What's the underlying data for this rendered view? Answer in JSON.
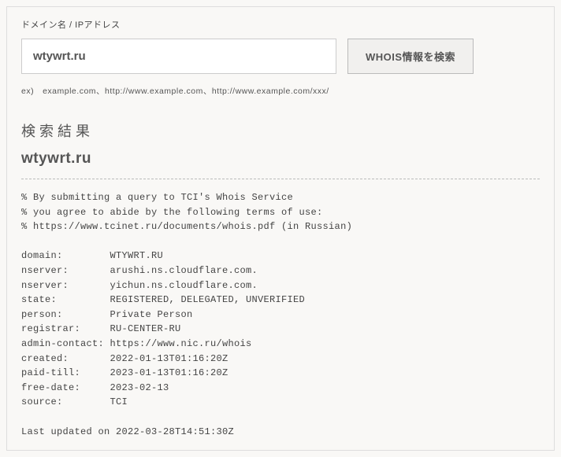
{
  "form": {
    "label": "ドメイン名 / IPアドレス",
    "input_value": "wtywrt.ru",
    "button_label": "WHOIS情報を検索",
    "example_text": "ex)　example.com、http://www.example.com、http://www.example.com/xxx/"
  },
  "result": {
    "heading": "検索結果",
    "domain": "wtywrt.ru",
    "whois_text": "% By submitting a query to TCI's Whois Service\n% you agree to abide by the following terms of use:\n% https://www.tcinet.ru/documents/whois.pdf (in Russian)\n\ndomain:        WTYWRT.RU\nnserver:       arushi.ns.cloudflare.com.\nnserver:       yichun.ns.cloudflare.com.\nstate:         REGISTERED, DELEGATED, UNVERIFIED\nperson:        Private Person\nregistrar:     RU-CENTER-RU\nadmin-contact: https://www.nic.ru/whois\ncreated:       2022-01-13T01:16:20Z\npaid-till:     2023-01-13T01:16:20Z\nfree-date:     2023-02-13\nsource:        TCI\n\nLast updated on 2022-03-28T14:51:30Z"
  }
}
